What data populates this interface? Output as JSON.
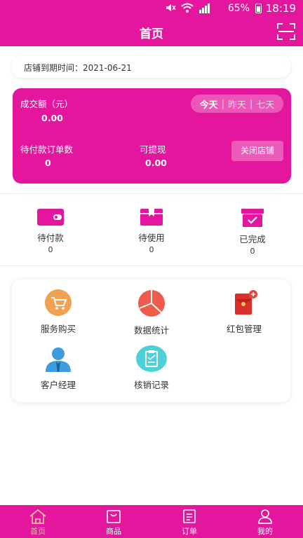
{
  "status_bar": {
    "battery": "65%",
    "time": "18:19",
    "icons": [
      "mute-icon",
      "wifi-icon",
      "signal-icon",
      "battery-icon"
    ]
  },
  "header": {
    "title": "首页",
    "scan_icon": "scan-icon"
  },
  "expiry": {
    "text": "店铺到期时间：2021-06-21"
  },
  "stats": {
    "turnover_label": "成交额（元）",
    "turnover_value": "0.00",
    "pending_orders_label": "待付款订单数",
    "pending_orders_value": "0",
    "withdrawable_label": "可提现",
    "withdrawable_value": "0.00",
    "range": {
      "today": "今天",
      "yesterday": "昨天",
      "seven_days": "七天",
      "separator": "|"
    },
    "close_shop_label": "关闭店铺"
  },
  "orders": [
    {
      "label": "待付款",
      "count": "0",
      "icon": "wallet-icon"
    },
    {
      "label": "待使用",
      "count": "0",
      "icon": "gift-box-icon"
    },
    {
      "label": "已完成",
      "count": "0",
      "icon": "check-box-icon"
    }
  ],
  "features": [
    {
      "label": "服务购买",
      "icon": "cart-icon"
    },
    {
      "label": "数据统计",
      "icon": "pie-chart-icon"
    },
    {
      "label": "红包管理",
      "icon": "red-envelope-icon"
    },
    {
      "label": "客户经理",
      "icon": "manager-icon"
    },
    {
      "label": "核销记录",
      "icon": "clipboard-icon"
    }
  ],
  "tabs": [
    {
      "label": "首页",
      "icon": "home-icon",
      "active": true
    },
    {
      "label": "商品",
      "icon": "bag-icon",
      "active": false
    },
    {
      "label": "订单",
      "icon": "order-icon",
      "active": false
    },
    {
      "label": "我的",
      "icon": "user-icon",
      "active": false
    }
  ],
  "colors": {
    "brand": "#e3169d",
    "active_tab": "#f6b8a4"
  }
}
